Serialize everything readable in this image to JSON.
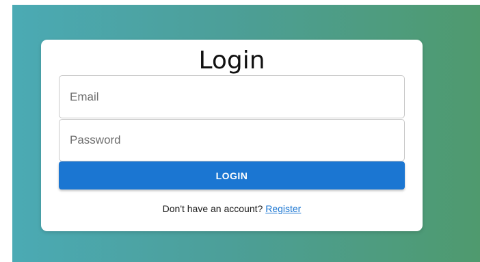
{
  "colors": {
    "gradient_start": "#4baab4",
    "gradient_end": "#4f9a6e",
    "accent": "#1b76d2",
    "card_bg": "#ffffff"
  },
  "login_form": {
    "title": "Login",
    "email": {
      "placeholder": "Email",
      "value": ""
    },
    "password": {
      "placeholder": "Password",
      "value": ""
    },
    "submit_label": "LOGIN",
    "register_prompt": "Don't have an account?",
    "register_link": "Register"
  }
}
